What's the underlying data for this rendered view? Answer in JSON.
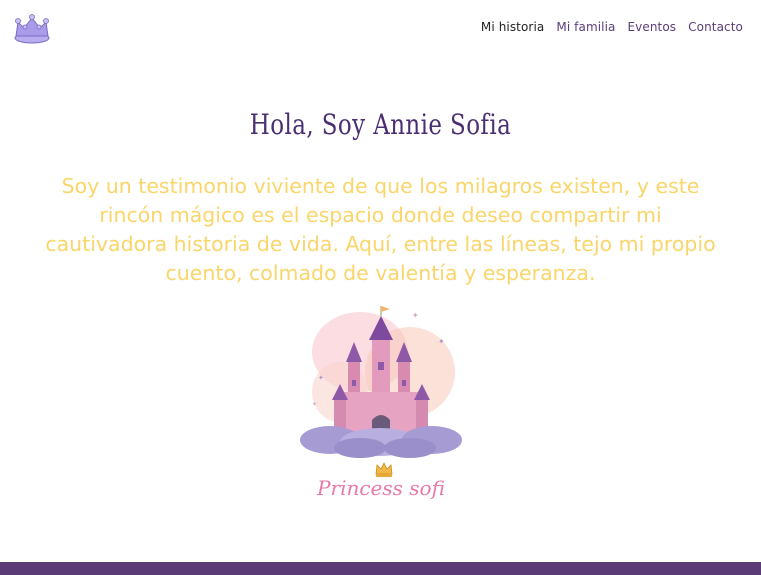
{
  "header": {
    "logo_icon": "crown-icon",
    "nav": [
      {
        "label": "Mi historia",
        "active": true
      },
      {
        "label": "Mi familia",
        "active": false
      },
      {
        "label": "Eventos",
        "active": false
      },
      {
        "label": "Contacto",
        "active": false
      }
    ]
  },
  "main": {
    "title": "Hola, Soy Annie Sofia",
    "intro": "Soy un testimonio viviente de que los milagros existen, y este rincón mágico es el espacio donde deseo compartir mi cautivadora historia de vida. Aquí, entre las líneas, tejo mi propio cuento, colmado de valentía y esperanza.",
    "illustration_icon": "castle-icon",
    "brand_text": "Princess sofi"
  },
  "colors": {
    "accent_purple": "#5a3b76",
    "intro_yellow": "#f9d56a",
    "brand_pink": "#e879a9",
    "crown_lavender": "#a99be8"
  }
}
